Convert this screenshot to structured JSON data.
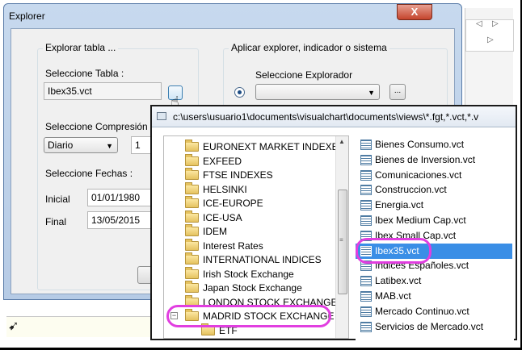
{
  "dialog": {
    "title": "Explorer",
    "close_label": "X"
  },
  "explore_group": {
    "title": "Explorar tabla ...",
    "table_label": "Seleccione Tabla :",
    "table_value": "Ibex35.vct",
    "compression_label": "Seleccione Compresión :",
    "compression_value": "Diario",
    "compression_count": "1",
    "dates_label": "Seleccione Fechas :",
    "start_label": "Inicial",
    "start_value": "01/01/1980",
    "end_label": "Final",
    "end_value": "13/05/2015"
  },
  "apply_group": {
    "title": "Aplicar explorer, indicador o sistema",
    "explorer_label": "Seleccione Explorador",
    "explorer_value": "",
    "browse_label": "..."
  },
  "browser": {
    "path": "c:\\users\\usuario1\\documents\\visualchart\\documents\\views\\*.fgt,*.vct,*.v",
    "tree": [
      {
        "label": "EURONEXT MARKET INDEXES",
        "expander": ""
      },
      {
        "label": "EXFEED",
        "expander": ""
      },
      {
        "label": "FTSE INDEXES",
        "expander": ""
      },
      {
        "label": "HELSINKI",
        "expander": ""
      },
      {
        "label": "ICE-EUROPE",
        "expander": ""
      },
      {
        "label": "ICE-USA",
        "expander": ""
      },
      {
        "label": "IDEM",
        "expander": ""
      },
      {
        "label": "Interest Rates",
        "expander": ""
      },
      {
        "label": "INTERNATIONAL INDICES",
        "expander": ""
      },
      {
        "label": "Irish Stock Exchange",
        "expander": ""
      },
      {
        "label": "Japan Stock Exchange",
        "expander": ""
      },
      {
        "label": "LONDON STOCK EXCHANGE",
        "expander": ""
      },
      {
        "label": "MADRID STOCK EXCHANGE",
        "expander": "−"
      },
      {
        "label": "ETF",
        "expander": ""
      }
    ],
    "files": [
      {
        "label": "Bienes Consumo.vct",
        "selected": false
      },
      {
        "label": "Bienes de Inversion.vct",
        "selected": false
      },
      {
        "label": "Comunicaciones.vct",
        "selected": false
      },
      {
        "label": "Construccion.vct",
        "selected": false
      },
      {
        "label": "Energia.vct",
        "selected": false
      },
      {
        "label": "Ibex Medium Cap.vct",
        "selected": false
      },
      {
        "label": "Ibex Small Cap.vct",
        "selected": false
      },
      {
        "label": "Ibex35.vct",
        "selected": true
      },
      {
        "label": "Indices Españoles.vct",
        "selected": false
      },
      {
        "label": "Latibex.vct",
        "selected": false
      },
      {
        "label": "MAB.vct",
        "selected": false
      },
      {
        "label": "Mercado Continuo.vct",
        "selected": false
      },
      {
        "label": "Servicios de Mercado.vct",
        "selected": false
      }
    ]
  },
  "colors": {
    "highlight": "#e13ee0",
    "selection": "#3a8ee6"
  },
  "icons": {
    "folder": "folder-icon",
    "file": "vct-file-icon",
    "cursor": "hand-cursor-icon"
  }
}
